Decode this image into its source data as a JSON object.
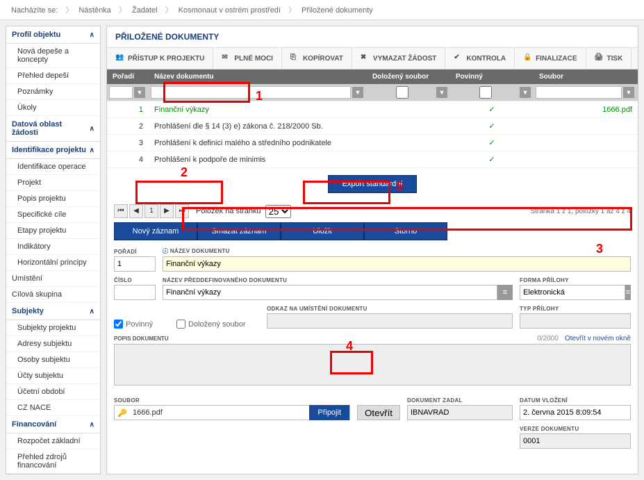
{
  "breadcrumb": {
    "label": "Nacházíte se:",
    "items": [
      "Nástěnka",
      "Žadatel",
      "Kosmonaut v ostrém prostředí",
      "Přiložené dokumenty"
    ]
  },
  "sidebar": {
    "s0": {
      "title": "Profil objektu",
      "items": [
        "Nová depeše a koncepty",
        "Přehled depeší",
        "Poznámky",
        "Úkoly"
      ]
    },
    "s1": {
      "title": "Datová oblast žádosti"
    },
    "s2": {
      "title": "Identifikace projektu",
      "items": [
        "Identifikace operace",
        "Projekt",
        "Popis projektu",
        "Specifické cíle",
        "Etapy projektu",
        "Indikátory",
        "Horizontální principy"
      ]
    },
    "s3": {
      "items": [
        "Umístění",
        "Cílová skupina"
      ]
    },
    "s4": {
      "title": "Subjekty",
      "items": [
        "Subjekty projektu",
        "Adresy subjektu",
        "Osoby subjektu",
        "Účty subjektu",
        "Účetní období",
        "CZ NACE"
      ]
    },
    "s5": {
      "title": "Financování",
      "items": [
        "Rozpočet základní",
        "Přehled zdrojů financování"
      ]
    }
  },
  "main": {
    "title": "PŘILOŽENÉ DOKUMENTY",
    "toolbar": {
      "pristup": "PŘÍSTUP K PROJEKTU",
      "plne": "PLNÉ MOCI",
      "kopirovat": "KOPÍROVAT",
      "vymazat": "VYMAZAT ŽÁDOST",
      "kontrola": "KONTROLA",
      "finalizace": "FINALIZACE",
      "tisk": "TISK"
    },
    "grid": {
      "cols": {
        "poradi": "Pořadí",
        "nazev": "Název dokumentu",
        "dolozeny": "Doložený soubor",
        "povinny": "Povinný",
        "soubor": "Soubor"
      },
      "rows": [
        {
          "n": "1",
          "name": "Finanční výkazy",
          "dol": "",
          "pov": "✓",
          "file": "1666.pdf",
          "green": true
        },
        {
          "n": "2",
          "name": "Prohlášení dle § 14 (3) e) zákona č. 218/2000 Sb.",
          "dol": "",
          "pov": "✓",
          "file": ""
        },
        {
          "n": "3",
          "name": "Prohlášení k definici malého a středního podnikatele",
          "dol": "",
          "pov": "✓",
          "file": ""
        },
        {
          "n": "4",
          "name": "Prohlášení k podpoře de minimis",
          "dol": "",
          "pov": "✓",
          "file": ""
        }
      ]
    },
    "export_btn": "Export standardní",
    "pager": {
      "page": "1",
      "label": "Položek na stránku",
      "size": "25",
      "info": "Stránka 1 z 1, položky 1 až 4 z 4"
    },
    "actions": {
      "novy": "Nový záznam",
      "smazat": "Smazat záznam",
      "ulozit": "Uložit",
      "storno": "Storno"
    },
    "form": {
      "poradi_lbl": "POŘADÍ",
      "poradi": "1",
      "nazev_lbl": "NÁZEV DOKUMENTU",
      "nazev": "Finanční výkazy",
      "cislo_lbl": "ČÍSLO",
      "cislo": "",
      "preddef_lbl": "NÁZEV PŘEDDEFINOVANÉHO DOKUMENTU",
      "preddef": "Finanční výkazy",
      "forma_lbl": "FORMA PŘÍLOHY",
      "forma": "Elektronická",
      "povinny_lbl": "Povinný",
      "dolozeny_lbl": "Doložený soubor",
      "odkaz_lbl": "ODKAZ NA UMÍSTĚNÍ DOKUMENTU",
      "odkaz": "",
      "typ_lbl": "TYP PŘÍLOHY",
      "typ": "",
      "popis_lbl": "POPIS DOKUMENTU",
      "popis_count": "0/2000",
      "popis_link": "Otevřít v novém okně",
      "soubor_lbl": "SOUBOR",
      "soubor": "1666.pdf",
      "pripojit": "Připojit",
      "otevrit": "Otevřít",
      "zadal_lbl": "DOKUMENT ZADAL",
      "zadal": "IBNAVRAD",
      "datum_lbl": "DATUM VLOŽENÍ",
      "datum": "2. června 2015 8:09:54",
      "verze_lbl": "VERZE DOKUMENTU",
      "verze": "0001"
    },
    "annotations": {
      "a1": "1",
      "a2": "2",
      "a3": "3",
      "a4": "4",
      "a5": "5"
    }
  }
}
